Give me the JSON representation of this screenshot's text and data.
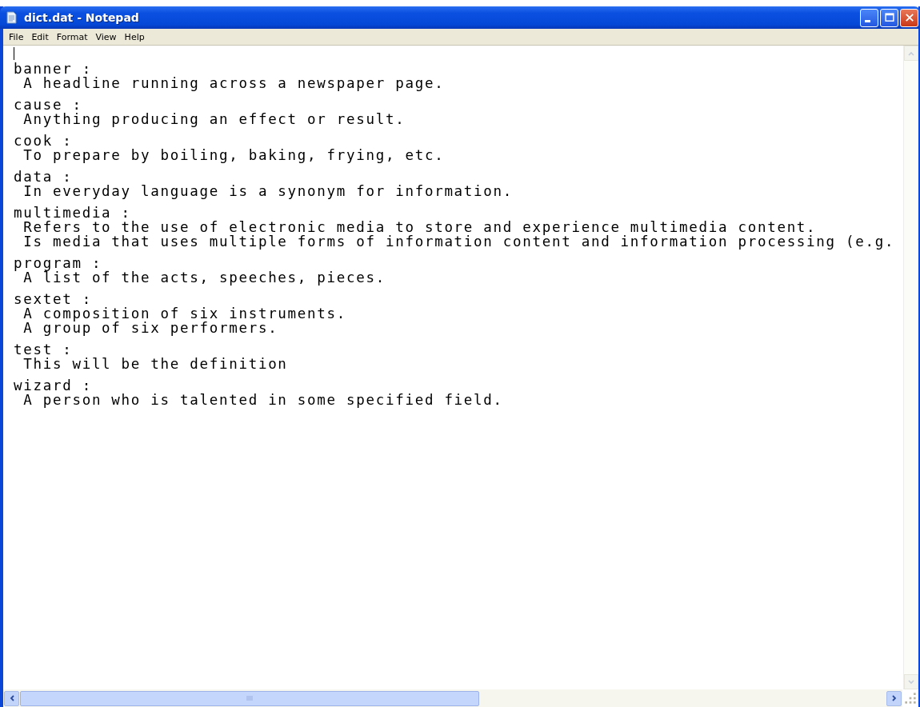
{
  "window": {
    "title": "dict.dat - Notepad"
  },
  "menu": [
    "File",
    "Edit",
    "Format",
    "View",
    "Help"
  ],
  "document": {
    "entries": [
      {
        "term": "banner :",
        "definitions": [
          " A headline running across a newspaper page."
        ]
      },
      {
        "term": "cause :",
        "definitions": [
          " Anything producing an effect or result."
        ]
      },
      {
        "term": "cook :",
        "definitions": [
          " To prepare by boiling, baking, frying, etc."
        ]
      },
      {
        "term": "data :",
        "definitions": [
          " In everyday language is a synonym for information."
        ]
      },
      {
        "term": "multimedia :",
        "definitions": [
          " Refers to the use of electronic media to store and experience multimedia content.",
          " Is media that uses multiple forms of information content and information processing (e.g."
        ]
      },
      {
        "term": "program :",
        "definitions": [
          " A list of the acts, speeches, pieces."
        ]
      },
      {
        "term": "sextet :",
        "definitions": [
          " A composition of six instruments.",
          " A group of six performers."
        ]
      },
      {
        "term": "test :",
        "definitions": [
          " This will be the definition"
        ]
      },
      {
        "term": "wizard :",
        "definitions": [
          " A person who is talented in some specified field."
        ]
      }
    ]
  }
}
